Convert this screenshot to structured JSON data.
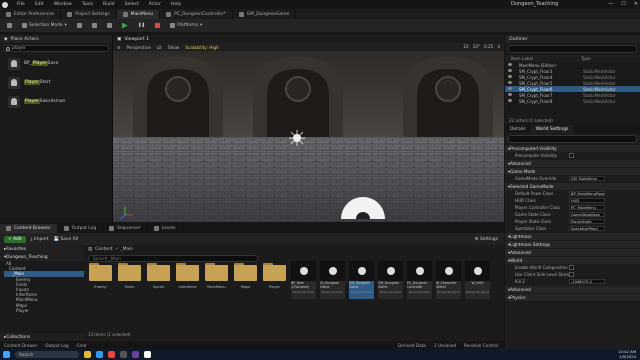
{
  "menubar": {
    "items": [
      "File",
      "Edit",
      "Window",
      "Tools",
      "Build",
      "Select",
      "Actor",
      "Help"
    ],
    "project_title": "Dungeon_Teaching"
  },
  "tabs": [
    {
      "label": "Editor Preferences",
      "active": false
    },
    {
      "label": "Project Settings",
      "active": false
    },
    {
      "label": "MainMenu",
      "active": true
    },
    {
      "label": "PC_DungeonController*",
      "active": false
    },
    {
      "label": "GM_DungeonGame",
      "active": false
    }
  ],
  "toolbar": {
    "selection_mode": "Selection Mode",
    "platforms": "Platforms"
  },
  "place_actors": {
    "title": "Place Actors",
    "search_value": "player",
    "items": [
      {
        "pre": "BP_",
        "hl": "Player",
        "post": "Save"
      },
      {
        "pre": "",
        "hl": "Player",
        "post": "Start"
      },
      {
        "pre": "",
        "hl": "Player",
        "post": "Swordsman"
      }
    ]
  },
  "viewport": {
    "title": "Viewport 1",
    "perspective": "Perspective",
    "lit": "Lit",
    "show": "Show",
    "scalability": "Scalability: High",
    "grid": "10",
    "angle": "10°",
    "scale": "0.25",
    "speed": "4"
  },
  "outliner": {
    "title": "Outliner",
    "col_label": "Item Label",
    "col_type": "Type",
    "rows": [
      {
        "name": "MainMenu (Editor)",
        "type": "",
        "sel": false
      },
      {
        "name": "SM_Crypt_Floor3",
        "type": "StaticMeshActor",
        "sel": false
      },
      {
        "name": "SM_Crypt_Floor4",
        "type": "StaticMeshActor",
        "sel": false
      },
      {
        "name": "SM_Crypt_Floor5",
        "type": "StaticMeshActor",
        "sel": false
      },
      {
        "name": "SM_Crypt_Floor6",
        "type": "StaticMeshActor",
        "sel": true
      },
      {
        "name": "SM_Crypt_Floor7",
        "type": "StaticMeshActor",
        "sel": false
      },
      {
        "name": "SM_Crypt_Floor8",
        "type": "StaticMeshActor",
        "sel": false
      }
    ],
    "footer": "22 actors (1 selected)"
  },
  "details": {
    "tab_details": "Details",
    "tab_world": "World Settings",
    "sections": [
      {
        "type": "sect",
        "label": "Precomputed Visibility"
      },
      {
        "type": "prop",
        "label": "Precompute Visibility",
        "kind": "check",
        "value": ""
      },
      {
        "type": "sect",
        "label": "Advanced"
      },
      {
        "type": "sect",
        "label": "Game Mode"
      },
      {
        "type": "prop",
        "label": "GameMode Override",
        "kind": "val",
        "value": "GM_MainMenu"
      },
      {
        "type": "sect",
        "label": "Selected GameMode"
      },
      {
        "type": "prop",
        "label": "Default Pawn Class",
        "kind": "val",
        "value": "BP_MainMenuPawn"
      },
      {
        "type": "prop",
        "label": "HUD Class",
        "kind": "val",
        "value": "HUD"
      },
      {
        "type": "prop",
        "label": "Player Controller Class",
        "kind": "val",
        "value": "PC_MainMenu"
      },
      {
        "type": "prop",
        "label": "Game State Class",
        "kind": "val",
        "value": "GameStateBase"
      },
      {
        "type": "prop",
        "label": "Player State Class",
        "kind": "val",
        "value": "PlayerState"
      },
      {
        "type": "prop",
        "label": "Spectator Class",
        "kind": "val",
        "value": "SpectatorPawn"
      },
      {
        "type": "sect",
        "label": "Lightmass"
      },
      {
        "type": "sect",
        "label": "Lightmass Settings"
      },
      {
        "type": "sect",
        "label": "Advanced"
      },
      {
        "type": "sect",
        "label": "World"
      },
      {
        "type": "prop",
        "label": "Enable World Composition",
        "kind": "check",
        "value": ""
      },
      {
        "type": "prop",
        "label": "Use Client Side Level Streaming",
        "kind": "check",
        "value": ""
      },
      {
        "type": "prop",
        "label": "Kill Z",
        "kind": "val",
        "value": "-1048575.0"
      },
      {
        "type": "sect",
        "label": "Advanced"
      },
      {
        "type": "sect",
        "label": "Physics"
      }
    ]
  },
  "content_browser": {
    "tabs": [
      "Content Browser",
      "Output Log",
      "Sequencer",
      "Levels"
    ],
    "add": "Add",
    "import": "Import",
    "save_all": "Save All",
    "settings": "Settings",
    "favorites": "Favorites",
    "project": "Dungeon_Teaching",
    "tree": [
      {
        "label": "All",
        "sel": false
      },
      {
        "label": "Content",
        "sel": false
      },
      {
        "label": "_Main",
        "sel": true
      },
      {
        "label": "Enemy",
        "sel": false
      },
      {
        "label": "Fonts",
        "sel": false
      },
      {
        "label": "Inputs",
        "sel": false
      },
      {
        "label": "Interfaces",
        "sel": false
      },
      {
        "label": "MainMenu",
        "sel": false
      },
      {
        "label": "Maps",
        "sel": false
      },
      {
        "label": "Player",
        "sel": false
      }
    ],
    "collections": "Collections",
    "breadcrumb": [
      "Content",
      "_Main"
    ],
    "search_placeholder": "Search _Main",
    "folders": [
      "Enemy",
      "Fonts",
      "Inputs",
      "Interfaces",
      "MainMenu",
      "Maps",
      "Player"
    ],
    "assets": [
      {
        "name": "BP_Item (Character)",
        "cls": "Blueprint Class",
        "sel": false
      },
      {
        "name": "GI_Dungeon Game",
        "cls": "Blueprint Class",
        "sel": false
      },
      {
        "name": "GM_Dungeon Game",
        "cls": "Blueprint Class",
        "sel": true
      },
      {
        "name": "GM_Dungeon Game",
        "cls": "Blueprint Class",
        "sel": false
      },
      {
        "name": "PC_Dungeon Controller",
        "cls": "Blueprint Class",
        "sel": false
      },
      {
        "name": "W_Character Select",
        "cls": "Widget Blueprint",
        "sel": false
      },
      {
        "name": "W_HUD",
        "cls": "Widget Blueprint",
        "sel": false
      }
    ],
    "footer": "13 items (1 selected)"
  },
  "statusbar": {
    "content_drawer": "Content Drawer",
    "output_log": "Output Log",
    "cmd": "Cmd",
    "derived": "Derived Data",
    "unsaved": "1 Unsaved",
    "revision": "Revision Control"
  },
  "taskbar": {
    "search": "Search",
    "time": "10:42 AM",
    "date": "1/9/2024"
  }
}
